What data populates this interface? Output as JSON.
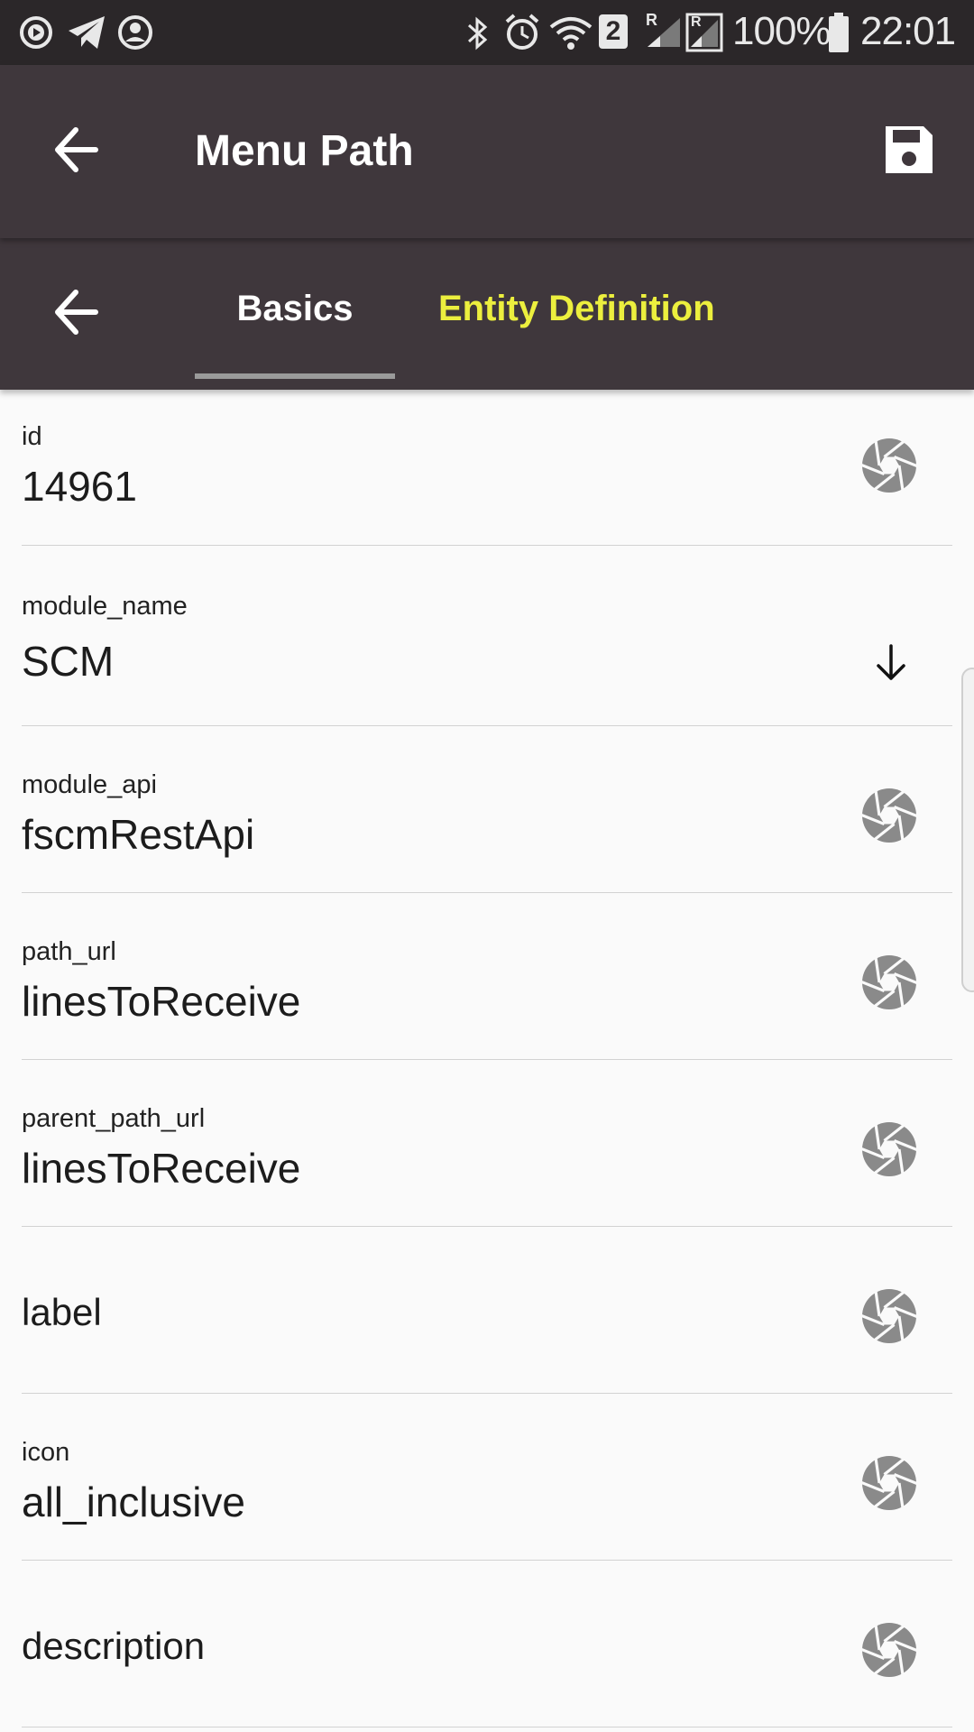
{
  "status_bar": {
    "battery": "100%",
    "time": "22:01",
    "sim_badge": "2",
    "roaming_a": "R",
    "roaming_b": "R",
    "icons_left": [
      "play-icon",
      "telegram-icon",
      "account-circle-icon"
    ],
    "icons_right": [
      "bluetooth-icon",
      "alarm-icon",
      "wifi-icon",
      "signal-icon",
      "battery-icon"
    ]
  },
  "app_bar": {
    "title": "Menu Path",
    "back_icon": "arrow-back-icon",
    "save_icon": "save-icon"
  },
  "tabs": {
    "back_icon": "arrow-back-icon",
    "items": [
      {
        "label": "Basics",
        "selected": true
      },
      {
        "label": "Entity Definition",
        "selected": false
      }
    ],
    "selected_color": "#ffffff",
    "unselected_color": "#ecef3e"
  },
  "fields": [
    {
      "label": "id",
      "value": "14961",
      "icon": "camera-aperture-icon"
    },
    {
      "label": "module_name",
      "value": "SCM",
      "icon": "arrow-down-icon"
    },
    {
      "label": "module_api",
      "value": "fscmRestApi",
      "icon": "camera-aperture-icon"
    },
    {
      "label": "path_url",
      "value": "linesToReceive",
      "icon": "camera-aperture-icon"
    },
    {
      "label": "parent_path_url",
      "value": "linesToReceive",
      "icon": "camera-aperture-icon"
    },
    {
      "label": "label",
      "value": "",
      "icon": "camera-aperture-icon"
    },
    {
      "label": "icon",
      "value": "all_inclusive",
      "icon": "camera-aperture-icon"
    },
    {
      "label": "description",
      "value": "",
      "icon": "camera-aperture-icon"
    }
  ],
  "colors": {
    "app_bar_bg": "#3f373c",
    "status_bar_bg": "#2b2729",
    "background": "#fafafa",
    "accent_yellow": "#ecef3e",
    "icon_grey": "#8a8a8a"
  }
}
